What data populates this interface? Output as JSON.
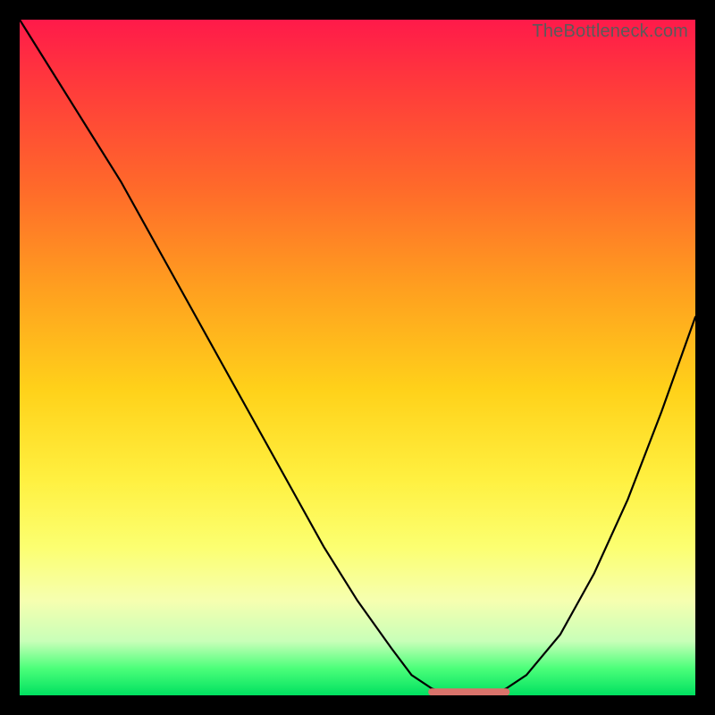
{
  "watermark": "TheBottleneck.com",
  "colors": {
    "background": "#000000",
    "gradient_top": "#ff1a4a",
    "gradient_bottom": "#00e060",
    "curve": "#000000",
    "flat_marker": "#d9736b"
  },
  "chart_data": {
    "type": "line",
    "title": "",
    "xlabel": "",
    "ylabel": "",
    "xlim": [
      0,
      100
    ],
    "ylim": [
      0,
      100
    ],
    "grid": false,
    "legend": false,
    "series": [
      {
        "name": "curve",
        "x": [
          0,
          5,
          10,
          15,
          20,
          25,
          30,
          35,
          40,
          45,
          50,
          55,
          58,
          61,
          64,
          67,
          70,
          72,
          75,
          80,
          85,
          90,
          95,
          100
        ],
        "y": [
          100,
          92,
          84,
          76,
          67,
          58,
          49,
          40,
          31,
          22,
          14,
          7,
          3,
          1,
          0,
          0,
          0,
          1,
          3,
          9,
          18,
          29,
          42,
          56
        ]
      }
    ],
    "annotations": [
      {
        "name": "flat-minimum-marker",
        "x_range": [
          61,
          72
        ],
        "y": 0.5,
        "color": "#d9736b"
      }
    ]
  }
}
